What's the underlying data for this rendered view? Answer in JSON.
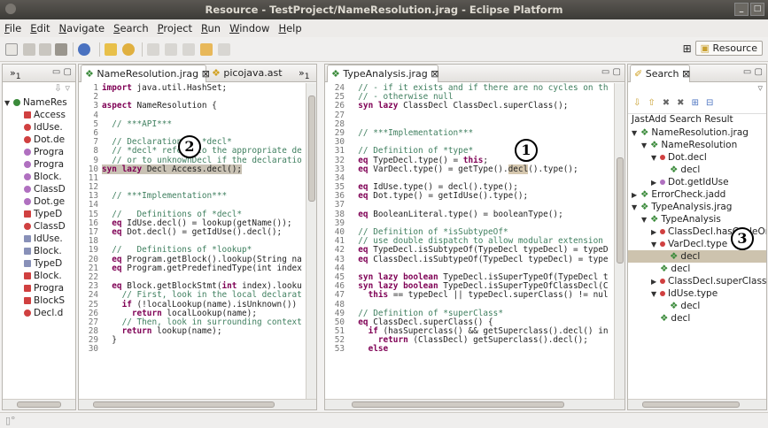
{
  "window": {
    "title": "Resource - TestProject/NameResolution.jrag - Eclipse Platform"
  },
  "menu": [
    "File",
    "Edit",
    "Navigate",
    "Search",
    "Project",
    "Run",
    "Window",
    "Help"
  ],
  "perspective": {
    "label": "Resource"
  },
  "left_panel": {
    "tab_label": "»",
    "tab_count": "1",
    "tree": [
      {
        "label": "NameRes",
        "icon": "aspect-file-icon",
        "color": "#3a8a3a",
        "twisty": "▼",
        "indent": 0
      },
      {
        "label": "Access",
        "color": "#d04040",
        "shape": "sq",
        "indent": 1
      },
      {
        "label": "IdUse.",
        "color": "#d04040",
        "shape": "dot",
        "indent": 1
      },
      {
        "label": "Dot.de",
        "color": "#d04040",
        "shape": "dot",
        "indent": 1
      },
      {
        "label": "Progra",
        "color": "#b070c0",
        "shape": "dot",
        "indent": 1
      },
      {
        "label": "Progra",
        "color": "#b070c0",
        "shape": "dot",
        "indent": 1
      },
      {
        "label": "Block.",
        "color": "#b070c0",
        "shape": "dot",
        "indent": 1
      },
      {
        "label": "ClassD",
        "color": "#b070c0",
        "shape": "dot",
        "indent": 1
      },
      {
        "label": "Dot.ge",
        "color": "#b070c0",
        "shape": "dot",
        "indent": 1
      },
      {
        "label": "TypeD",
        "color": "#d04040",
        "shape": "sq",
        "indent": 1
      },
      {
        "label": "ClassD",
        "color": "#d04040",
        "shape": "dot",
        "indent": 1
      },
      {
        "label": "IdUse.",
        "color": "#8890b8",
        "shape": "sq",
        "indent": 1
      },
      {
        "label": "Block.",
        "color": "#8890b8",
        "shape": "sq",
        "indent": 1
      },
      {
        "label": "TypeD",
        "color": "#8890b8",
        "shape": "sq",
        "indent": 1
      },
      {
        "label": "Block.",
        "color": "#d04040",
        "shape": "sq",
        "indent": 1
      },
      {
        "label": "Progra",
        "color": "#d04040",
        "shape": "sq",
        "indent": 1
      },
      {
        "label": "BlockS",
        "color": "#d04040",
        "shape": "sq",
        "indent": 1
      },
      {
        "label": "Decl.d",
        "color": "#d04040",
        "shape": "dot",
        "indent": 1
      }
    ]
  },
  "editor1": {
    "tabs": [
      "NameResolution.jrag",
      "picojava.ast"
    ],
    "more": "»",
    "more_count": "1",
    "marker": "2",
    "lines": [
      [
        {
          "t": "import ",
          "k": "k"
        },
        {
          "t": "java.util.HashSet;"
        }
      ],
      [],
      [
        {
          "t": "aspect ",
          "k": "k"
        },
        {
          "t": "NameResolution {"
        }
      ],
      [],
      [
        {
          "t": "  // ***API***",
          "k": "c"
        }
      ],
      [],
      [
        {
          "t": "  // Declaration of *decl*",
          "k": "c"
        }
      ],
      [
        {
          "t": "  // *decl* refers to the appropriate de",
          "k": "c"
        }
      ],
      [
        {
          "t": "  // or to unknownDecl if the declaratio",
          "k": "c"
        }
      ],
      [
        {
          "t": "syn lazy ",
          "k": "k",
          "hl": "1"
        },
        {
          "t": "Decl Access.decl();",
          "hl": "1"
        }
      ],
      [],
      [],
      [
        {
          "t": "  // ***Implementation***",
          "k": "c"
        }
      ],
      [],
      [
        {
          "t": "  //   Definitions of *decl*",
          "k": "c"
        }
      ],
      [
        {
          "t": "  eq ",
          "k": "k"
        },
        {
          "t": "IdUse.decl() = lookup(getName());"
        }
      ],
      [
        {
          "t": "  eq ",
          "k": "k"
        },
        {
          "t": "Dot.decl() = getIdUse().decl();"
        }
      ],
      [],
      [
        {
          "t": "  //   Definitions of *lookup*",
          "k": "c"
        }
      ],
      [
        {
          "t": "  eq ",
          "k": "k"
        },
        {
          "t": "Program.getBlock().lookup(String na"
        }
      ],
      [
        {
          "t": "  eq ",
          "k": "k"
        },
        {
          "t": "Program.getPredefinedType(int index"
        }
      ],
      [],
      [
        {
          "t": "  eq ",
          "k": "k"
        },
        {
          "t": "Block.getBlockStmt("
        },
        {
          "t": "int ",
          "k": "k"
        },
        {
          "t": "index).looku"
        }
      ],
      [
        {
          "t": "    // First, look in the local declarat",
          "k": "c"
        }
      ],
      [
        {
          "t": "    if ",
          "k": "k"
        },
        {
          "t": "(!localLookup(name).isUnknown())"
        }
      ],
      [
        {
          "t": "      return ",
          "k": "k"
        },
        {
          "t": "localLookup(name);"
        }
      ],
      [
        {
          "t": "    // Then, look in surrounding context",
          "k": "c"
        }
      ],
      [
        {
          "t": "    return ",
          "k": "k"
        },
        {
          "t": "lookup(name);"
        }
      ],
      [
        {
          "t": "  }"
        }
      ],
      []
    ]
  },
  "editor2": {
    "tab": "TypeAnalysis.jrag",
    "marker": "1",
    "start": 24,
    "lines": [
      [
        {
          "t": "  // - if it exists and if there are no cycles on th",
          "k": "c"
        }
      ],
      [
        {
          "t": "  // - otherwise null",
          "k": "c"
        }
      ],
      [
        {
          "t": "  syn lazy ",
          "k": "k"
        },
        {
          "t": "ClassDecl ClassDecl.superClass();"
        }
      ],
      [],
      [],
      [
        {
          "t": "  // ***Implementation***",
          "k": "c"
        }
      ],
      [],
      [
        {
          "t": "  // Definition of *type*",
          "k": "c"
        }
      ],
      [
        {
          "t": "  eq ",
          "k": "k"
        },
        {
          "t": "TypeDecl.type() = "
        },
        {
          "t": "this",
          "k": "k"
        },
        {
          "t": ";"
        }
      ],
      [
        {
          "t": "  eq ",
          "k": "k"
        },
        {
          "t": "VarDecl.type() = getType()."
        },
        {
          "t": "decl",
          "hl": "2"
        },
        {
          "t": "().type();"
        }
      ],
      [],
      [
        {
          "t": "  eq ",
          "k": "k"
        },
        {
          "t": "IdUse.type() = decl().type();"
        }
      ],
      [
        {
          "t": "  eq ",
          "k": "k"
        },
        {
          "t": "Dot.type() = getIdUse().type();"
        }
      ],
      [],
      [
        {
          "t": "  eq ",
          "k": "k"
        },
        {
          "t": "BooleanLiteral.type() = booleanType();"
        }
      ],
      [],
      [
        {
          "t": "  // Definition of *isSubtypeOf*",
          "k": "c"
        }
      ],
      [
        {
          "t": "  // use double dispatch to allow modular extension",
          "k": "c"
        }
      ],
      [
        {
          "t": "  eq ",
          "k": "k"
        },
        {
          "t": "TypeDecl.isSubtypeOf(TypeDecl typeDecl) = typeD"
        }
      ],
      [
        {
          "t": "  eq ",
          "k": "k"
        },
        {
          "t": "ClassDecl.isSubtypeOf(TypeDecl typeDecl) = type"
        }
      ],
      [],
      [
        {
          "t": "  syn lazy boolean ",
          "k": "k"
        },
        {
          "t": "TypeDecl.isSuperTypeOf(TypeDecl t"
        }
      ],
      [
        {
          "t": "  syn lazy boolean ",
          "k": "k"
        },
        {
          "t": "TypeDecl.isSuperTypeOfClassDecl(C"
        }
      ],
      [
        {
          "t": "    this ",
          "k": "k"
        },
        {
          "t": "== typeDecl || typeDecl.superClass() != nul"
        }
      ],
      [],
      [
        {
          "t": "  // Definition of *superClass*",
          "k": "c"
        }
      ],
      [
        {
          "t": "  eq ",
          "k": "k"
        },
        {
          "t": "ClassDecl.superClass() {"
        }
      ],
      [
        {
          "t": "    if ",
          "k": "k"
        },
        {
          "t": "(hasSuperclass() && getSuperclass().decl() in"
        }
      ],
      [
        {
          "t": "      return ",
          "k": "k"
        },
        {
          "t": "(ClassDecl) getSuperclass().decl();"
        }
      ],
      [
        {
          "t": "    else",
          "k": "k"
        }
      ]
    ]
  },
  "search": {
    "tab": "Search",
    "header": "JastAdd Search Result",
    "marker": "3",
    "tree": [
      {
        "label": "NameResolution.jrag",
        "twisty": "▼",
        "icon": "jrag",
        "indent": 0
      },
      {
        "label": "NameResolution",
        "twisty": "▼",
        "icon": "aspect",
        "indent": 1
      },
      {
        "label": "Dot.decl",
        "twisty": "▼",
        "icon": "dot",
        "color": "#d04040",
        "indent": 2
      },
      {
        "label": "decl",
        "twisty": "",
        "icon": "aspect",
        "indent": 3
      },
      {
        "label": "Dot.getIdUse",
        "twisty": "▶",
        "icon": "dot",
        "color": "#b070c0",
        "indent": 2
      },
      {
        "label": "ErrorCheck.jadd",
        "twisty": "▶",
        "icon": "jrag",
        "indent": 0
      },
      {
        "label": "TypeAnalysis.jrag",
        "twisty": "▼",
        "icon": "jrag",
        "indent": 0
      },
      {
        "label": "TypeAnalysis",
        "twisty": "▼",
        "icon": "aspect",
        "indent": 1
      },
      {
        "label": "ClassDecl.hasCycleOnS",
        "twisty": "▶",
        "icon": "dot",
        "color": "#d04040",
        "indent": 2
      },
      {
        "label": "VarDecl.type",
        "twisty": "▼",
        "icon": "dot",
        "color": "#d04040",
        "indent": 2
      },
      {
        "label": "decl",
        "twisty": "",
        "icon": "aspect",
        "indent": 3,
        "sel": true
      },
      {
        "label": "decl",
        "twisty": "",
        "icon": "aspect",
        "indent": 2
      },
      {
        "label": "ClassDecl.superClass",
        "twisty": "▶",
        "icon": "dot",
        "color": "#d04040",
        "indent": 2
      },
      {
        "label": "IdUse.type",
        "twisty": "▼",
        "icon": "dot",
        "color": "#d04040",
        "indent": 2
      },
      {
        "label": "decl",
        "twisty": "",
        "icon": "aspect",
        "indent": 3
      },
      {
        "label": "decl",
        "twisty": "",
        "icon": "aspect",
        "indent": 2
      }
    ]
  }
}
